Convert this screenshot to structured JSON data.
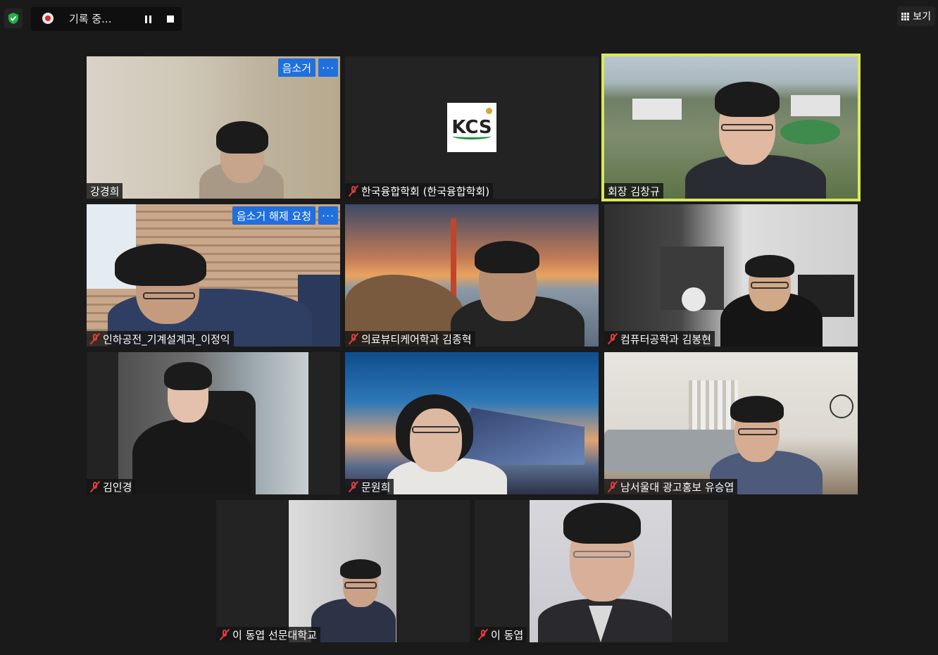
{
  "recording": {
    "status": "기록 중..."
  },
  "view_button": {
    "label": "보기"
  },
  "participants": [
    {
      "name": "강경희",
      "muted": false,
      "chip": "음소거",
      "more": "···"
    },
    {
      "name": "한국융합학회 (한국융합학회)",
      "muted": true,
      "logo": "KCS"
    },
    {
      "name": "회장 김창규",
      "muted": false,
      "active_speaker": true
    },
    {
      "name": "인하공전_기계설계과_이정익",
      "muted": true,
      "chip": "음소거 해제 요청",
      "more": "···"
    },
    {
      "name": "의료뷰티케어학과 김종혁",
      "muted": true
    },
    {
      "name": "컴퓨터공학과 김봉현",
      "muted": true
    },
    {
      "name": "김인경",
      "muted": true
    },
    {
      "name": "문원희",
      "muted": true
    },
    {
      "name": "남서울대 광고홍보 유승엽",
      "muted": true
    },
    {
      "name": "이 동엽 선문대학교",
      "muted": true
    },
    {
      "name": "이 동엽",
      "muted": true
    }
  ],
  "colors": {
    "active_border": "#d9e85a",
    "chip_blue": "#1f6fde",
    "mute_red": "#e23a3a",
    "background": "#1a1a1a"
  }
}
